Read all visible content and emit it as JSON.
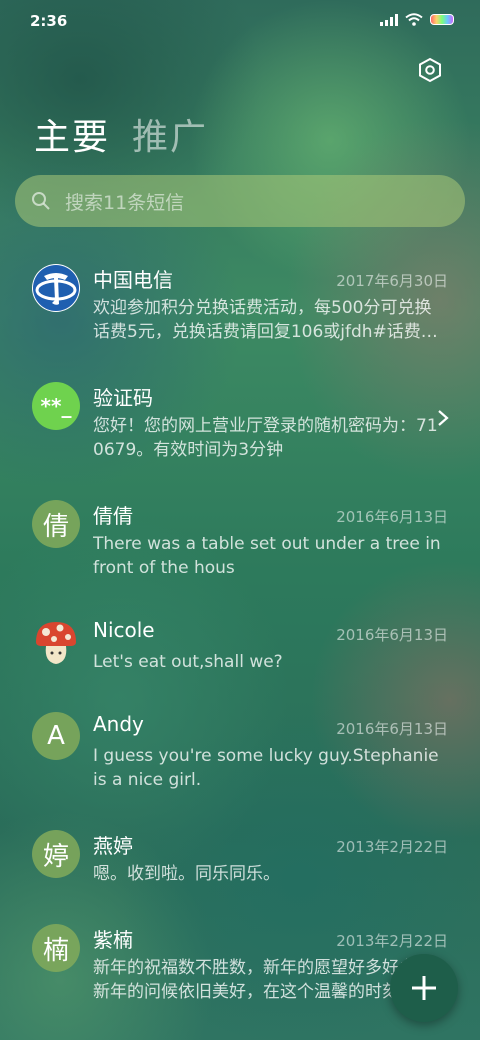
{
  "status_bar": {
    "time": "2:36"
  },
  "tabs": [
    {
      "label": "主要"
    },
    {
      "label": "推广"
    }
  ],
  "search": {
    "placeholder": "搜索11条短信"
  },
  "messages": [
    {
      "name": "中国电信",
      "date": "2017年6月30日",
      "preview": "欢迎参加积分兑换话费活动，每500分可兑换话费5元，兑换话费请回复106或jfdh#话费…",
      "avatar": "china-telecom-logo"
    },
    {
      "name": "验证码",
      "date": "",
      "preview": "您好！您的网上营业厅登录的随机密码为：710679。有效时间为3分钟",
      "avatar_text": "**_"
    },
    {
      "name": "倩倩",
      "date": "2016年6月13日",
      "preview": "There was a table set out under a tree in front of the hous",
      "avatar_text": "倩"
    },
    {
      "name": "Nicole",
      "date": "2016年6月13日",
      "preview": "Let's eat out,shall we?",
      "avatar": "mushroom"
    },
    {
      "name": "Andy",
      "date": "2016年6月13日",
      "preview": "I guess you're some lucky guy.Stephanie is a nice girl.",
      "avatar_text": "A"
    },
    {
      "name": "燕婷",
      "date": "2013年2月22日",
      "preview": "嗯。收到啦。同乐同乐。",
      "avatar_text": "婷"
    },
    {
      "name": "紫楠",
      "date": "2013年2月22日",
      "preview": "新年的祝福数不胜数，新年的愿望好多好多，新年的问候依旧美好，在这个温馨的时刻",
      "avatar_text": "楠"
    }
  ],
  "colors": {
    "accent_fab": "#1e5e4a",
    "avatar_fill": "#82aa5a",
    "verify_avatar": "#6fd24e"
  },
  "icons": {
    "settings": "settings-hexagon-icon",
    "search": "search-icon",
    "fab": "plus-icon",
    "chevron": "chevron-right-icon"
  }
}
